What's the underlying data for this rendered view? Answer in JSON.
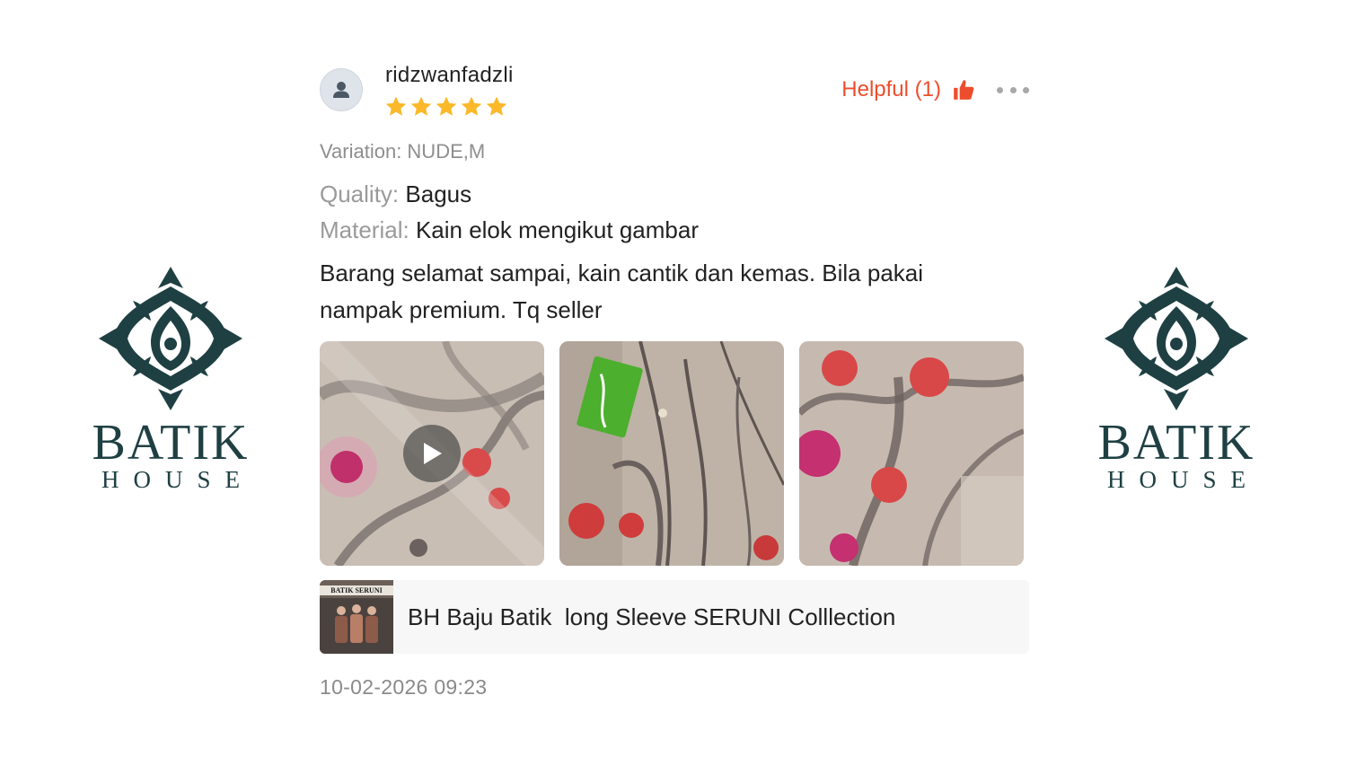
{
  "brand": {
    "word1": "BATIK",
    "word2": "HOUSE",
    "color": "#1f4043",
    "icon": "batik-ornament-logo"
  },
  "review": {
    "username": "ridzwanfadzli",
    "rating": 5,
    "rating_max": 5,
    "helpful_label": "Helpful (1)",
    "variation": "Variation: NUDE,M",
    "attributes": [
      {
        "key": "Quality:",
        "value": "Bagus"
      },
      {
        "key": "Material:",
        "value": "Kain elok mengikut gambar"
      }
    ],
    "body": "Barang selamat sampai, kain cantik dan kemas. Bila pakai nampak premium. Tq seller",
    "media": [
      {
        "kind": "video",
        "icon": "play-icon"
      },
      {
        "kind": "image"
      },
      {
        "kind": "image"
      }
    ],
    "product": {
      "thumb_title": "BATIK SERUNI",
      "name": "BH Baju Batik  long Sleeve SERUNI Colllection"
    },
    "timestamp": "10-02-2026 09:23"
  },
  "colors": {
    "accent": "#ee4d2d",
    "star": "#fbb829",
    "muted_text": "#8e8e8e"
  }
}
